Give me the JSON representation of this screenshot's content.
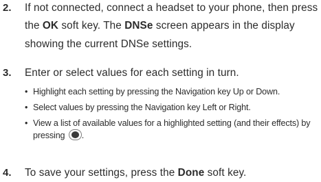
{
  "steps": [
    {
      "number": "2.",
      "t1": "If not connected, connect a headset to your phone, then press the ",
      "b1": "OK",
      "t2": " soft key. The ",
      "b2": "DNSe",
      "t3": " screen appears in the display showing the current DNSe settings."
    },
    {
      "number": "3.",
      "text": "Enter or select values for each setting in turn.",
      "bullets": [
        "Highlight each setting by pressing the Navigation key Up or Down.",
        "Select values by pressing the Navigation key Left or Right.",
        "View a list of available values for a highlighted setting (and their effects) by pressing"
      ],
      "bullet_suffix": "."
    },
    {
      "number": "4.",
      "t1": "To save your settings, press the ",
      "b1": "Done",
      "t2": " soft key."
    }
  ],
  "icons": {
    "nav_center_key": "navigation-center-key-icon",
    "bullet": "•"
  }
}
